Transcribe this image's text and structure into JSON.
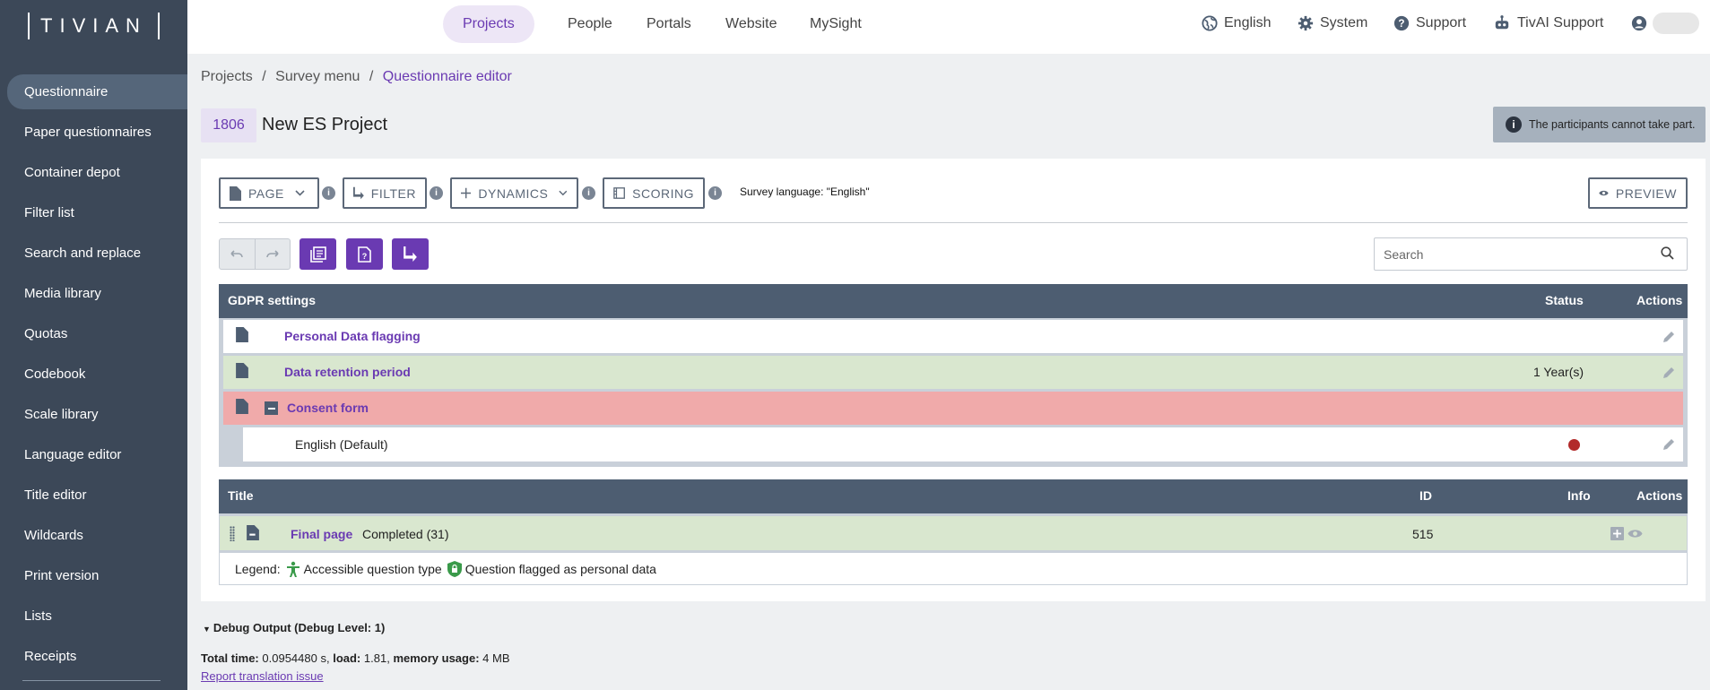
{
  "logo": "TIVIAN",
  "sidebar": {
    "items": [
      {
        "label": "Questionnaire",
        "active": true
      },
      {
        "label": "Paper questionnaires"
      },
      {
        "label": "Container depot"
      },
      {
        "label": "Filter list"
      },
      {
        "label": "Search and replace"
      },
      {
        "label": "Media library"
      },
      {
        "label": "Quotas"
      },
      {
        "label": "Codebook"
      },
      {
        "label": "Scale library"
      },
      {
        "label": "Language editor"
      },
      {
        "label": "Title editor"
      },
      {
        "label": "Wildcards"
      },
      {
        "label": "Print version"
      },
      {
        "label": "Lists"
      },
      {
        "label": "Receipts"
      }
    ]
  },
  "topnav": {
    "tabs": [
      "Projects",
      "People",
      "Portals",
      "Website",
      "MySight"
    ],
    "active_tab": "Projects",
    "language": "English",
    "system": "System",
    "support": "Support",
    "ai_support": "TivAI Support"
  },
  "breadcrumb": {
    "items": [
      "Projects",
      "Survey menu",
      "Questionnaire editor"
    ],
    "separator": "/"
  },
  "project": {
    "id": "1806",
    "name": "New ES Project"
  },
  "notice": "The participants cannot take part.",
  "toolbar": {
    "page": "PAGE",
    "filter": "FILTER",
    "dynamics": "DYNAMICS",
    "scoring": "SCORING",
    "survey_language": "Survey language: \"English\"",
    "preview": "PREVIEW"
  },
  "search": {
    "placeholder": "Search"
  },
  "gdpr_table": {
    "headers": {
      "title": "GDPR settings",
      "status": "Status",
      "actions": "Actions"
    },
    "rows": [
      {
        "label": "Personal Data flagging",
        "status": ""
      },
      {
        "label": "Data retention period",
        "status": "1 Year(s)"
      },
      {
        "label": "Consent form",
        "status": ""
      },
      {
        "label": "English (Default)",
        "status": "red-dot"
      }
    ]
  },
  "pages_table": {
    "headers": {
      "title": "Title",
      "id": "ID",
      "info": "Info",
      "actions": "Actions"
    },
    "rows": [
      {
        "link": "Final page",
        "text": "Completed (31)",
        "id": "515"
      }
    ]
  },
  "legend": {
    "label": "Legend:",
    "accessible": "Accessible question type",
    "flagged": "Question flagged as personal data"
  },
  "debug": {
    "title": "Debug Output (Debug Level: 1)",
    "total_time_label": "Total time:",
    "total_time": "0.0954480 s,",
    "load_label": "load:",
    "load": "1.81,",
    "memory_label": "memory usage:",
    "memory": "4 MB",
    "report_link": "Report translation issue"
  },
  "colors": {
    "brand": "#6a3ab2",
    "sidebar": "#3c4858",
    "table_header": "#4d5d71",
    "row_green": "#d9e7cf",
    "row_red": "#f0aaaa",
    "status_red": "#b22a2a"
  }
}
